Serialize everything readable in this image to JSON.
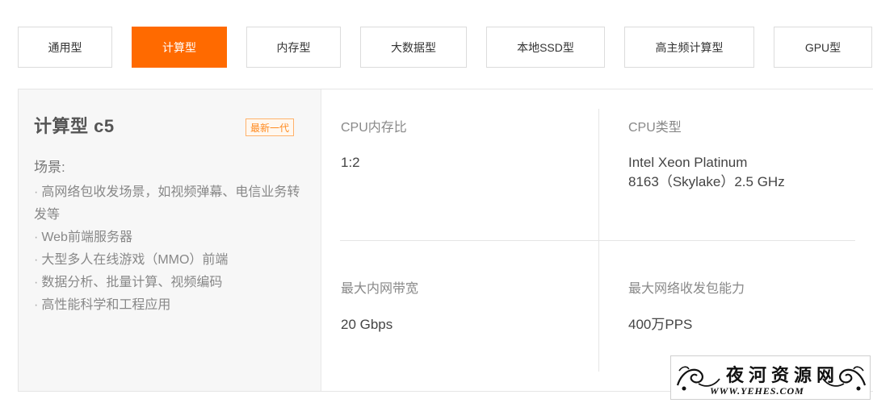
{
  "tabs": [
    {
      "label": "通用型",
      "active": false
    },
    {
      "label": "计算型",
      "active": true
    },
    {
      "label": "内存型",
      "active": false
    },
    {
      "label": "大数据型",
      "active": false
    },
    {
      "label": "本地SSD型",
      "active": false
    },
    {
      "label": "高主频计算型",
      "active": false
    },
    {
      "label": "GPU型",
      "active": false
    }
  ],
  "instance": {
    "title": "计算型 c5",
    "badge": "最新一代",
    "scene_label": "场景:",
    "scenes": [
      "高网络包收发场景，如视频弹幕、电信业务转发等",
      "Web前端服务器",
      "大型多人在线游戏（MMO）前端",
      "数据分析、批量计算、视频编码",
      "高性能科学和工程应用"
    ]
  },
  "specs": {
    "cpu_mem_ratio": {
      "label": "CPU内存比",
      "value": "1:2"
    },
    "cpu_type": {
      "label": "CPU类型",
      "value_line1": "Intel Xeon Platinum",
      "value_line2": "8163（Skylake）2.5 GHz"
    },
    "max_bandwidth": {
      "label": "最大内网带宽",
      "value": "20 Gbps"
    },
    "max_pps": {
      "label": "最大网络收发包能力",
      "value": "400万PPS"
    }
  },
  "watermark": {
    "title": "夜河资源网",
    "url": "WWW.YEHES.COM"
  },
  "colors": {
    "accent": "#ff6a00",
    "badge": "#ff8a1e"
  }
}
